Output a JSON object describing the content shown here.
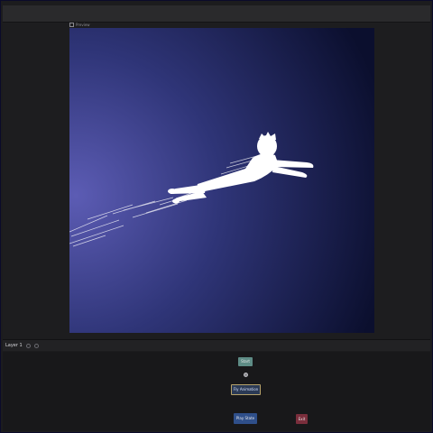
{
  "toolbar": {
    "canvas_label": "Preview"
  },
  "layer": {
    "name": "Layer 1"
  },
  "nodes": {
    "start_label": "Start",
    "animation_label": "Fly Animation",
    "play_label": "Play State",
    "stop_label": "Exit"
  },
  "colors": {
    "artboard_light": "#5a5ab0",
    "artboard_dark": "#0d1030",
    "figure": "#ffffff"
  }
}
